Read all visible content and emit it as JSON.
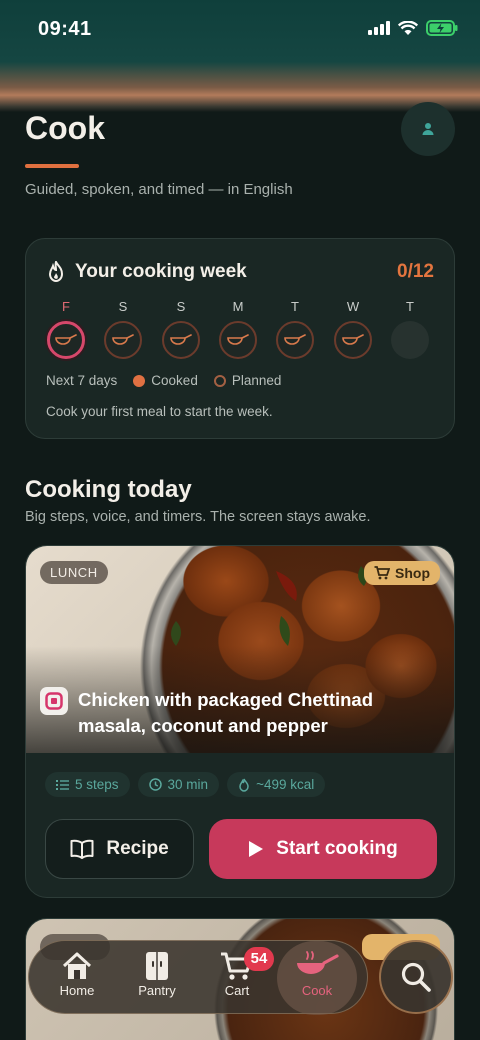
{
  "status_bar": {
    "time": "09:41"
  },
  "header": {
    "title": "Cook",
    "subtitle": "Guided, spoken, and timed — in English",
    "profile_icon": "person-icon"
  },
  "week": {
    "title": "Your cooking week",
    "count": "0/12",
    "days": [
      {
        "letter": "F",
        "state": "today"
      },
      {
        "letter": "S",
        "state": "planned"
      },
      {
        "letter": "S",
        "state": "planned"
      },
      {
        "letter": "M",
        "state": "planned"
      },
      {
        "letter": "T",
        "state": "planned"
      },
      {
        "letter": "W",
        "state": "planned"
      },
      {
        "letter": "T",
        "state": "empty"
      }
    ],
    "legend_range": "Next 7 days",
    "legend_cooked": "Cooked",
    "legend_planned": "Planned",
    "hint": "Cook your first meal to start the week.",
    "colors": {
      "accent": "#e3753f",
      "today": "#d6486b"
    }
  },
  "today": {
    "title": "Cooking today",
    "subtitle": "Big steps, voice, and timers. The screen stays awake."
  },
  "recipe": {
    "meal": "LUNCH",
    "shop_label": "Shop",
    "title": "Chicken with packaged Chettinad masala, coconut and pepper",
    "steps": "5 steps",
    "time": "30 min",
    "kcal": "~499 kcal",
    "recipe_button": "Recipe",
    "start_button": "Start cooking"
  },
  "nav": {
    "items": [
      {
        "label": "Home",
        "icon": "home-icon"
      },
      {
        "label": "Pantry",
        "icon": "fridge-icon"
      },
      {
        "label": "Cart",
        "icon": "cart-icon",
        "badge": "54"
      },
      {
        "label": "Cook",
        "icon": "pan-icon",
        "active": true
      }
    ],
    "search_icon": "search-icon"
  }
}
